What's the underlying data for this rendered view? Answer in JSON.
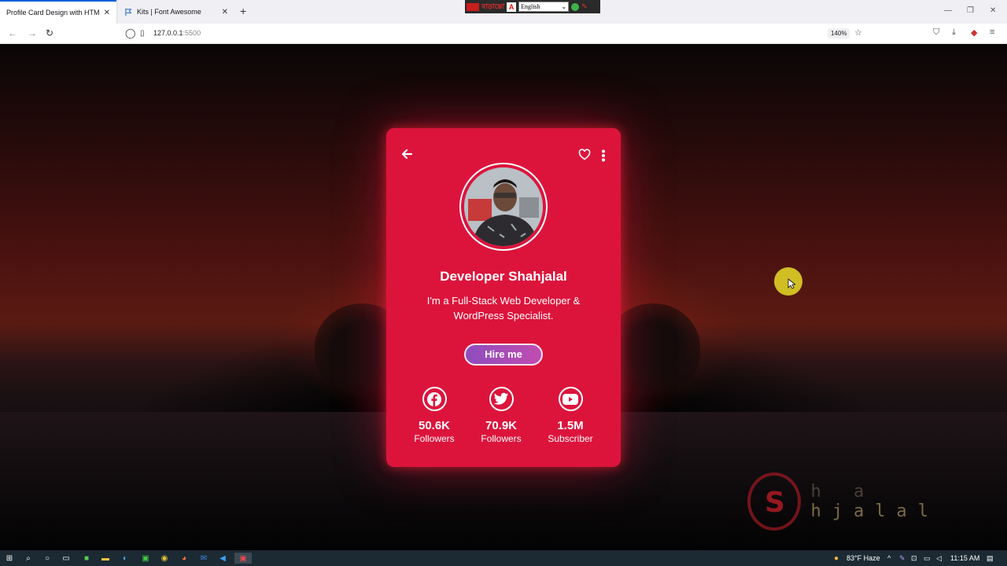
{
  "browser": {
    "tabs": [
      {
        "title": "Profile Card Design with HTML & C",
        "active": true
      },
      {
        "title": "Kits | Font Awesome",
        "active": false
      }
    ],
    "url_host": "127.0.0.1",
    "url_port": ":5500",
    "zoom": "140%",
    "language_bar": {
      "bengali": "বাড়ান্তো",
      "selected": "English"
    }
  },
  "card": {
    "name": "Developer Shahjalal",
    "bio": "I'm a Full-Stack Web Developer & WordPress Specialist.",
    "hire_label": "Hire me",
    "accent": "#dc143c",
    "stats": [
      {
        "icon": "facebook-icon",
        "count": "50.6K",
        "label": "Followers"
      },
      {
        "icon": "twitter-icon",
        "count": "70.9K",
        "label": "Followers"
      },
      {
        "icon": "youtube-icon",
        "count": "1.5M",
        "label": "Subscriber"
      }
    ]
  },
  "watermark": {
    "letters_dim": "h a",
    "letters_bright": "hjalal"
  },
  "taskbar": {
    "weather": "83°F  Haze",
    "time": "11:15 AM"
  }
}
